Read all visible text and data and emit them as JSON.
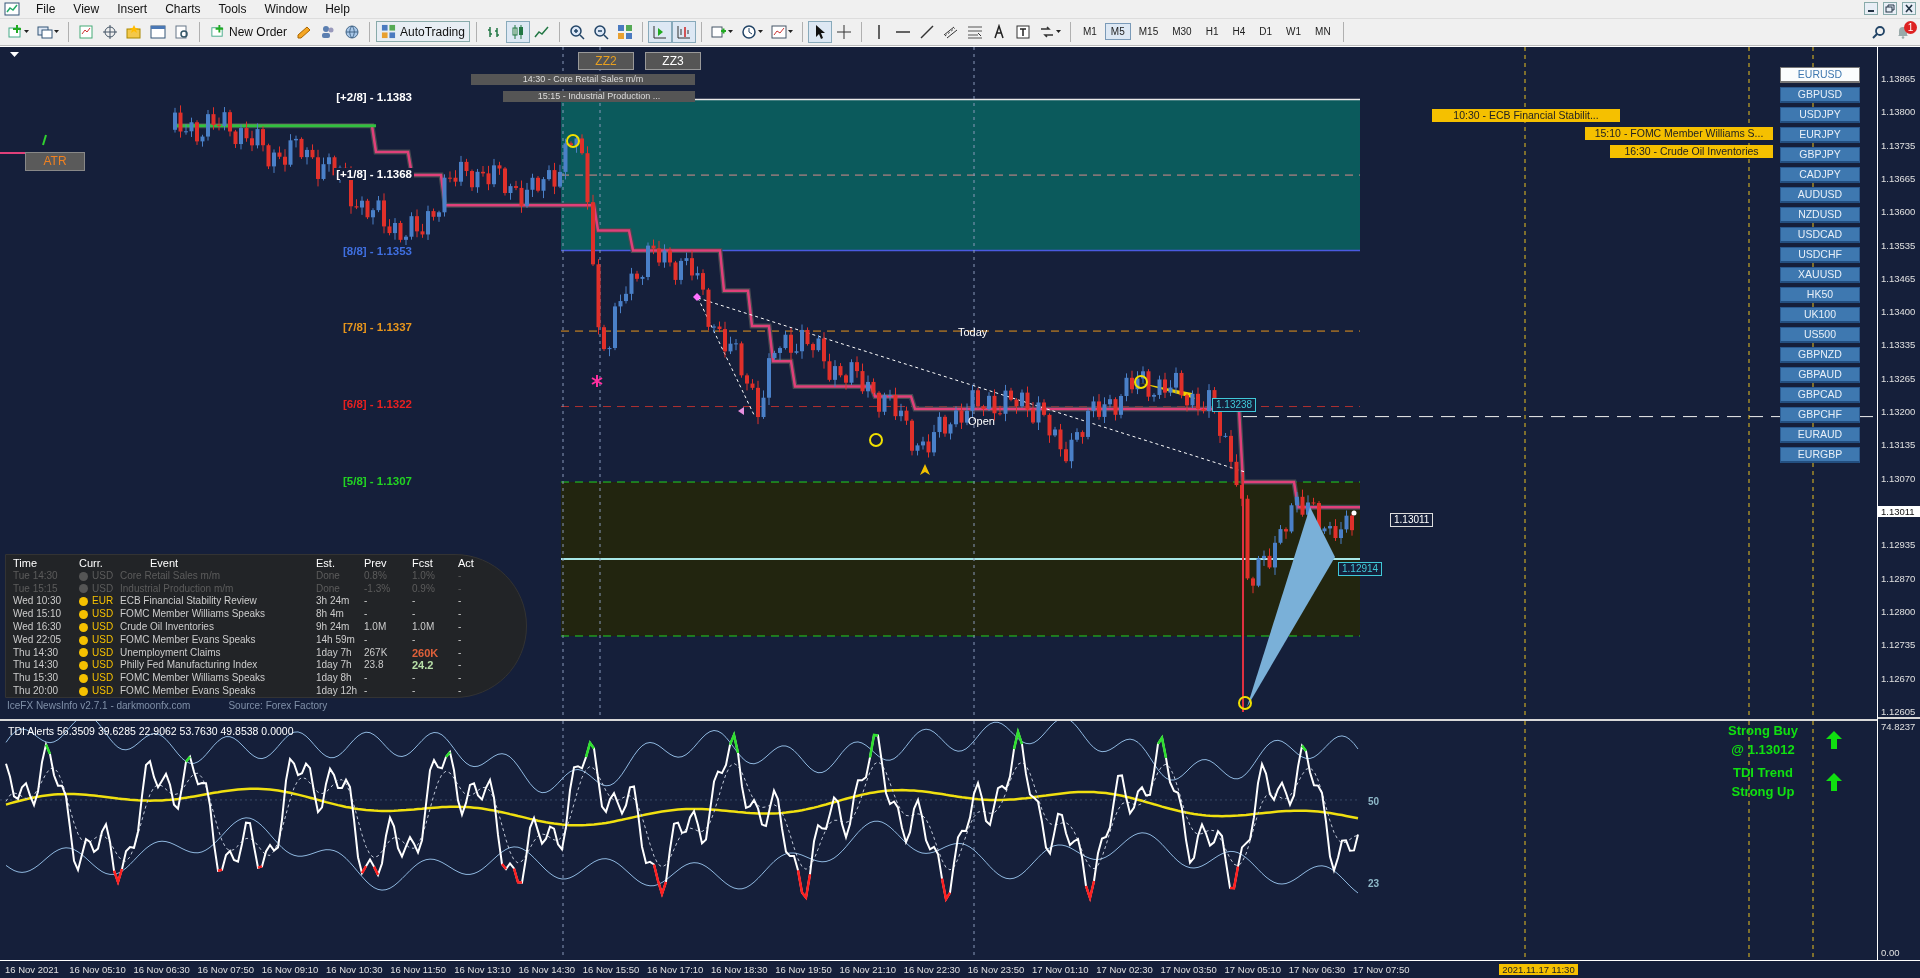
{
  "menu": [
    "File",
    "View",
    "Insert",
    "Charts",
    "Tools",
    "Window",
    "Help"
  ],
  "toolbar": {
    "buttons": [
      "New Order",
      "AutoTrading"
    ],
    "timeframes": [
      {
        "label": "M1",
        "selected": false
      },
      {
        "label": "M5",
        "selected": true
      },
      {
        "label": "M15",
        "selected": false
      },
      {
        "label": "M30",
        "selected": false
      },
      {
        "label": "H1",
        "selected": false
      },
      {
        "label": "H4",
        "selected": false
      },
      {
        "label": "D1",
        "selected": false
      },
      {
        "label": "W1",
        "selected": false
      },
      {
        "label": "MN",
        "selected": false
      }
    ],
    "notifications": "1"
  },
  "chart": {
    "zigzag_buttons": [
      "ZZ2",
      "ZZ3"
    ],
    "news_marks": [
      "14:30 - Core Retail Sales m/m",
      "15:15 - Industrial Production ..."
    ],
    "atr": "ATR",
    "levels": [
      {
        "label": "[+2/8] - 1.1383",
        "color": "#ffffff"
      },
      {
        "label": "[+1/8] - 1.1368",
        "color": "#ffffff"
      },
      {
        "label": "[8/8] - 1.1353",
        "color": "#3f6fe0"
      },
      {
        "label": "[7/8] - 1.1337",
        "color": "#e8961c"
      },
      {
        "label": "[6/8] - 1.1322",
        "color": "#e82020"
      },
      {
        "label": "[5/8] - 1.1307",
        "color": "#22d422"
      }
    ],
    "today": "Today",
    "open": "Open",
    "price_tags": [
      {
        "text": "1.13238",
        "kind": "level"
      },
      {
        "text": "1.12914",
        "kind": "level"
      },
      {
        "text": "1.13011",
        "kind": "last"
      }
    ],
    "event_tags": [
      "10:30 - ECB Financial Stabilit...",
      "15:10 - FOMC Member Williams S...",
      "16:30 - Crude Oil Inventories"
    ],
    "symbols": [
      {
        "label": "EURUSD",
        "selected": true
      },
      {
        "label": "GBPUSD",
        "selected": false
      },
      {
        "label": "USDJPY",
        "selected": false
      },
      {
        "label": "EURJPY",
        "selected": false
      },
      {
        "label": "GBPJPY",
        "selected": false
      },
      {
        "label": "CADJPY",
        "selected": false
      },
      {
        "label": "AUDUSD",
        "selected": false
      },
      {
        "label": "NZDUSD",
        "selected": false
      },
      {
        "label": "USDCAD",
        "selected": false
      },
      {
        "label": "USDCHF",
        "selected": false
      },
      {
        "label": "XAUUSD",
        "selected": false
      },
      {
        "label": "HK50",
        "selected": false
      },
      {
        "label": "UK100",
        "selected": false
      },
      {
        "label": "US500",
        "selected": false
      },
      {
        "label": "GBPNZD",
        "selected": false
      },
      {
        "label": "GBPAUD",
        "selected": false
      },
      {
        "label": "GBPCAD",
        "selected": false
      },
      {
        "label": "GBPCHF",
        "selected": false
      },
      {
        "label": "EURAUD",
        "selected": false
      },
      {
        "label": "EURGBP",
        "selected": false
      }
    ],
    "news": {
      "columns": [
        "Time",
        "Curr.",
        "Event",
        "Est.",
        "Prev",
        "Fcst",
        "Act"
      ],
      "rows": [
        {
          "time": "Tue  14:30",
          "color": "#555555",
          "currency": "USD",
          "event": "Core Retail Sales m/m",
          "est": "Done",
          "prev": "0.8%",
          "fcst": "1.0%",
          "act": "-",
          "done": true
        },
        {
          "time": "Tue  15:15",
          "color": "#555555",
          "currency": "USD",
          "event": "Industrial Production m/m",
          "est": "Done",
          "prev": "-1.3%",
          "fcst": "0.9%",
          "act": "-",
          "done": true
        },
        {
          "time": "Wed  10:30",
          "color": "#f5c000",
          "currency": "EUR",
          "event": "ECB Financial Stability Review",
          "est": "3h 24m",
          "prev": "-",
          "fcst": "-",
          "act": "-",
          "done": false
        },
        {
          "time": "Wed  15:10",
          "color": "#f5c000",
          "currency": "USD",
          "event": "FOMC Member Williams Speaks",
          "est": "8h 4m",
          "prev": "-",
          "fcst": "-",
          "act": "-",
          "done": false
        },
        {
          "time": "Wed  16:30",
          "color": "#f5c000",
          "currency": "USD",
          "event": "Crude Oil Inventories",
          "est": "9h 24m",
          "prev": "1.0M",
          "fcst": "1.0M",
          "act": "-",
          "done": false
        },
        {
          "time": "Wed  22:05",
          "color": "#f5c000",
          "currency": "USD",
          "event": "FOMC Member Evans Speaks",
          "est": "14h 59m",
          "prev": "-",
          "fcst": "-",
          "act": "-",
          "done": false
        },
        {
          "time": "Thu  14:30",
          "color": "#f5c000",
          "currency": "USD",
          "event": "Unemployment Claims",
          "est": "1day 7h",
          "prev": "267K",
          "fcst": {
            "text": "260K",
            "color": "#e0603a"
          },
          "act": "-",
          "done": false
        },
        {
          "time": "Thu  14:30",
          "color": "#f5c000",
          "currency": "USD",
          "event": "Philly Fed Manufacturing Index",
          "est": "1day 7h",
          "prev": "23.8",
          "fcst": {
            "text": "24.2",
            "color": "#b8e0a8"
          },
          "act": "-",
          "done": false
        },
        {
          "time": "Thu  15:30",
          "color": "#f5c000",
          "currency": "USD",
          "event": "FOMC Member Williams Speaks",
          "est": "1day 8h",
          "prev": "-",
          "fcst": "-",
          "act": "-",
          "done": false
        },
        {
          "time": "Thu  20:00",
          "color": "#f5c000",
          "currency": "USD",
          "event": "FOMC Member Evans Speaks",
          "est": "1day 12h",
          "prev": "-",
          "fcst": "-",
          "act": "-",
          "done": false
        }
      ],
      "footer": "IceFX NewsInfo v2.7.1  -  darkmoonfx.com",
      "source": "Source: Forex Factory"
    },
    "price_axis": [
      {
        "text": "1.13865",
        "kind": "tick"
      },
      {
        "text": "1.13800",
        "kind": "tick"
      },
      {
        "text": "1.13735",
        "kind": "tick"
      },
      {
        "text": "1.13665",
        "kind": "tick"
      },
      {
        "text": "1.13600",
        "kind": "tick"
      },
      {
        "text": "1.13535",
        "kind": "tick"
      },
      {
        "text": "1.13465",
        "kind": "tick"
      },
      {
        "text": "1.13400",
        "kind": "tick"
      },
      {
        "text": "1.13335",
        "kind": "tick"
      },
      {
        "text": "1.13265",
        "kind": "tick"
      },
      {
        "text": "1.13200",
        "kind": "tick"
      },
      {
        "text": "1.13135",
        "kind": "tick"
      },
      {
        "text": "1.13070",
        "kind": "tick"
      },
      {
        "text": "1.13011",
        "kind": "current"
      },
      {
        "text": "1.12935",
        "kind": "tick"
      },
      {
        "text": "1.12870",
        "kind": "tick"
      },
      {
        "text": "1.12800",
        "kind": "tick"
      },
      {
        "text": "1.12735",
        "kind": "tick"
      },
      {
        "text": "1.12670",
        "kind": "tick"
      },
      {
        "text": "1.12605",
        "kind": "tick"
      }
    ]
  },
  "indicator": {
    "title": "TDI Alerts 56.3509 39.6285 22.9062 53.7630 49.8538 0.0000",
    "levels": [
      "50",
      "23"
    ],
    "signals": [
      {
        "lines": [
          "Strong Buy",
          "@ 1.13012"
        ]
      },
      {
        "lines": [
          "TDI Trend",
          "Strong Up"
        ]
      }
    ],
    "axis": [
      "74.8237",
      "0.00"
    ]
  },
  "time_axis": {
    "labels": [
      "16 Nov 2021",
      "16 Nov 05:10",
      "16 Nov 06:30",
      "16 Nov 07:50",
      "16 Nov 09:10",
      "16 Nov 10:30",
      "16 Nov 11:50",
      "16 Nov 13:10",
      "16 Nov 14:30",
      "16 Nov 15:50",
      "16 Nov 17:10",
      "16 Nov 18:30",
      "16 Nov 19:50",
      "16 Nov 21:10",
      "16 Nov 22:30",
      "16 Nov 23:50",
      "17 Nov 01:10",
      "17 Nov 02:30",
      "17 Nov 03:50",
      "17 Nov 05:10",
      "17 Nov 06:30",
      "17 Nov 07:50"
    ],
    "cursor": "2021.11.17 11:30"
  }
}
